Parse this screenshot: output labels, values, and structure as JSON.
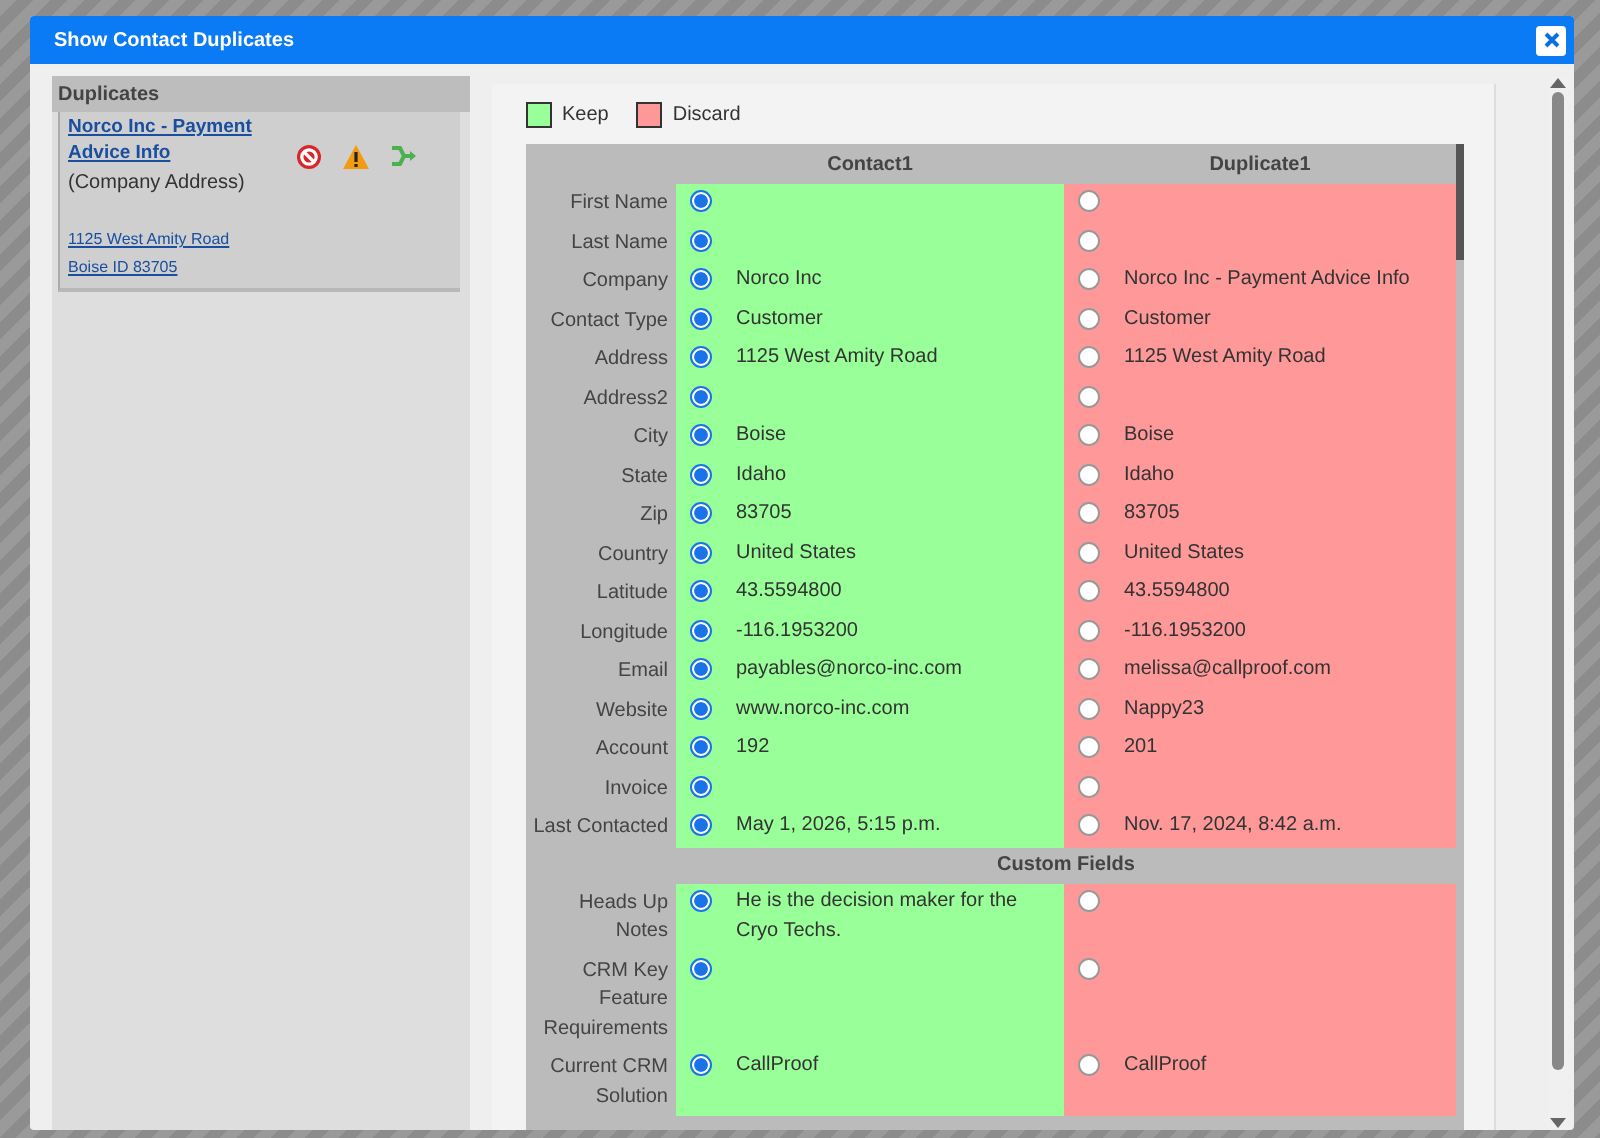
{
  "dialog": {
    "title": "Show Contact Duplicates"
  },
  "duplicates_panel": {
    "title": "Duplicates",
    "items": [
      {
        "name": "Norco Inc - Payment Advice Info",
        "note": "(Company Address)",
        "address_lines": [
          "1125 West Amity Road",
          "Boise ID 83705"
        ]
      }
    ]
  },
  "legend": [
    {
      "label": "Keep",
      "color": "#99ff99"
    },
    {
      "label": "Discard",
      "color": "#ff9999"
    }
  ],
  "table": {
    "columns": [
      {
        "label": "Contact1",
        "color": "#99ff99"
      },
      {
        "label": "Duplicate1",
        "color": "#ff9999"
      }
    ],
    "sections": [
      {
        "rows": [
          {
            "label": "First Name",
            "values": [
              {
                "selected": true
              },
              {
                "selected": false
              }
            ]
          },
          {
            "label": "Last Name",
            "values": [
              {
                "selected": true
              },
              {
                "selected": false
              }
            ]
          },
          {
            "label": "Company",
            "values": [
              {
                "text": "Norco Inc",
                "selected": true
              },
              {
                "text": "Norco Inc - Payment Advice Info",
                "selected": false
              }
            ]
          },
          {
            "label": "Contact Type",
            "values": [
              {
                "text": "Customer",
                "selected": true
              },
              {
                "text": "Customer",
                "selected": false
              }
            ]
          },
          {
            "label": "Address",
            "values": [
              {
                "text": "1125 West Amity Road",
                "selected": true
              },
              {
                "text": "1125 West Amity Road",
                "selected": false
              }
            ]
          },
          {
            "label": "Address2",
            "values": [
              {
                "selected": true
              },
              {
                "selected": false
              }
            ]
          },
          {
            "label": "City",
            "values": [
              {
                "text": "Boise",
                "selected": true
              },
              {
                "text": "Boise",
                "selected": false
              }
            ]
          },
          {
            "label": "State",
            "values": [
              {
                "text": "Idaho",
                "selected": true
              },
              {
                "text": "Idaho",
                "selected": false
              }
            ]
          },
          {
            "label": "Zip",
            "values": [
              {
                "text": "83705",
                "selected": true
              },
              {
                "text": "83705",
                "selected": false
              }
            ]
          },
          {
            "label": "Country",
            "values": [
              {
                "text": "United States",
                "selected": true
              },
              {
                "text": "United States",
                "selected": false
              }
            ]
          },
          {
            "label": "Latitude",
            "values": [
              {
                "text": "43.5594800",
                "selected": true
              },
              {
                "text": "43.5594800",
                "selected": false
              }
            ]
          },
          {
            "label": "Longitude",
            "values": [
              {
                "text": "-116.1953200",
                "selected": true
              },
              {
                "text": "-116.1953200",
                "selected": false
              }
            ]
          },
          {
            "label": "Email",
            "values": [
              {
                "text": "payables@norco-inc.com",
                "selected": true
              },
              {
                "text": "melissa@callproof.com",
                "selected": false
              }
            ]
          },
          {
            "label": "Website",
            "values": [
              {
                "text": "www.norco-inc.com",
                "selected": true
              },
              {
                "text": "Nappy23",
                "selected": false
              }
            ]
          },
          {
            "label": "Account",
            "values": [
              {
                "text": "192",
                "selected": true
              },
              {
                "text": "201",
                "selected": false
              }
            ]
          },
          {
            "label": "Invoice",
            "values": [
              {
                "selected": true
              },
              {
                "selected": false
              }
            ]
          },
          {
            "label": "Last Contacted",
            "values": [
              {
                "text": "May 1, 2026, 5:15 p.m.",
                "selected": true
              },
              {
                "text": "Nov. 17, 2024, 8:42 a.m.",
                "selected": false
              }
            ]
          }
        ]
      },
      {
        "title": "Custom Fields",
        "rows": [
          {
            "label": "Heads Up Notes",
            "values": [
              {
                "text": "He is the decision maker for the Cryo Techs.",
                "selected": true
              },
              {
                "selected": false
              }
            ]
          },
          {
            "label": "CRM Key Feature Requirements",
            "values": [
              {
                "selected": true
              },
              {
                "selected": false
              }
            ]
          },
          {
            "label": "Current CRM Solution",
            "values": [
              {
                "text": "CallProof",
                "selected": true
              },
              {
                "text": "CallProof",
                "selected": false
              }
            ]
          }
        ]
      }
    ]
  }
}
